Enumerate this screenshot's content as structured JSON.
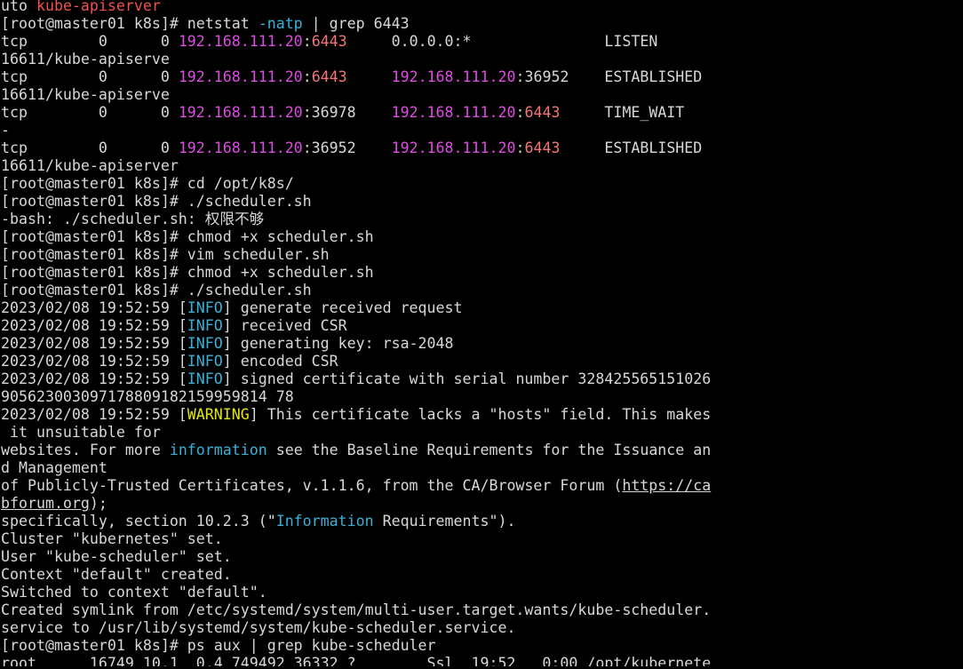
{
  "terminal": {
    "colors": {
      "background": "#000000",
      "foreground": "#d8d8d8",
      "red": "#f0524f",
      "magenta": "#e04be6",
      "salmon": "#f57575",
      "cyan": "#39b1d6",
      "yellow": "#e5e510"
    },
    "lines": [
      [
        {
          "t": "uto "
        },
        {
          "t": "kube-apiserver",
          "c": "red"
        }
      ],
      [
        {
          "t": "[root@master01 k8s]# netstat "
        },
        {
          "t": "-natp",
          "c": "cyan"
        },
        {
          "t": " | grep 6443"
        }
      ],
      [
        {
          "t": "tcp        0      0 "
        },
        {
          "t": "192.168.111.20",
          "c": "magenta"
        },
        {
          "t": ":"
        },
        {
          "t": "6443",
          "c": "salmon"
        },
        {
          "t": "     0.0.0.0:*               LISTEN"
        }
      ],
      [
        {
          "t": "16611/kube-apiserve"
        }
      ],
      [
        {
          "t": "tcp        0      0 "
        },
        {
          "t": "192.168.111.20",
          "c": "magenta"
        },
        {
          "t": ":"
        },
        {
          "t": "6443",
          "c": "salmon"
        },
        {
          "t": "     "
        },
        {
          "t": "192.168.111.20",
          "c": "magenta"
        },
        {
          "t": ":36952    ESTABLISHED"
        }
      ],
      [
        {
          "t": "16611/kube-apiserve"
        }
      ],
      [
        {
          "t": "tcp        0      0 "
        },
        {
          "t": "192.168.111.20",
          "c": "magenta"
        },
        {
          "t": ":36978    "
        },
        {
          "t": "192.168.111.20",
          "c": "magenta"
        },
        {
          "t": ":"
        },
        {
          "t": "6443",
          "c": "salmon"
        },
        {
          "t": "     TIME_WAIT"
        }
      ],
      [
        {
          "t": "-"
        }
      ],
      [
        {
          "t": "tcp        0      0 "
        },
        {
          "t": "192.168.111.20",
          "c": "magenta"
        },
        {
          "t": ":36952    "
        },
        {
          "t": "192.168.111.20",
          "c": "magenta"
        },
        {
          "t": ":"
        },
        {
          "t": "6443",
          "c": "salmon"
        },
        {
          "t": "     ESTABLISHED"
        }
      ],
      [
        {
          "t": "16611/kube-apiserver"
        }
      ],
      [
        {
          "t": "[root@master01 k8s]# cd /opt/k8s/"
        }
      ],
      [
        {
          "t": "[root@master01 k8s]# ./scheduler.sh"
        }
      ],
      [
        {
          "t": "-bash: ./scheduler.sh: 权限不够"
        }
      ],
      [
        {
          "t": "[root@master01 k8s]# chmod +x scheduler.sh"
        }
      ],
      [
        {
          "t": "[root@master01 k8s]# vim scheduler.sh"
        }
      ],
      [
        {
          "t": "[root@master01 k8s]# chmod +x scheduler.sh"
        }
      ],
      [
        {
          "t": "[root@master01 k8s]# ./scheduler.sh"
        }
      ],
      [
        {
          "t": "2023/02/08 19:52:59 ["
        },
        {
          "t": "INFO",
          "c": "cyan"
        },
        {
          "t": "] generate received request"
        }
      ],
      [
        {
          "t": "2023/02/08 19:52:59 ["
        },
        {
          "t": "INFO",
          "c": "cyan"
        },
        {
          "t": "] received CSR"
        }
      ],
      [
        {
          "t": "2023/02/08 19:52:59 ["
        },
        {
          "t": "INFO",
          "c": "cyan"
        },
        {
          "t": "] generating key: rsa-2048"
        }
      ],
      [
        {
          "t": "2023/02/08 19:52:59 ["
        },
        {
          "t": "INFO",
          "c": "cyan"
        },
        {
          "t": "] encoded CSR"
        }
      ],
      [
        {
          "t": "2023/02/08 19:52:59 ["
        },
        {
          "t": "INFO",
          "c": "cyan"
        },
        {
          "t": "] signed certificate with serial number 328425565151026"
        }
      ],
      [
        {
          "t": "905623003097178809182159959814 78"
        }
      ],
      [
        {
          "t": "2023/02/08 19:52:59 ["
        },
        {
          "t": "WARNING",
          "c": "yellow"
        },
        {
          "t": "] This certificate lacks a \"hosts\" field. This makes"
        }
      ],
      [
        {
          "t": " it unsuitable for"
        }
      ],
      [
        {
          "t": "websites. For more "
        },
        {
          "t": "information",
          "c": "cyan"
        },
        {
          "t": " see the Baseline Requirements for the Issuance an"
        }
      ],
      [
        {
          "t": "d Management"
        }
      ],
      [
        {
          "t": "of Publicly-Trusted Certificates, v.1.1.6, from the CA/Browser Forum ("
        },
        {
          "t": "https://ca",
          "u": true
        }
      ],
      [
        {
          "t": "bforum.org",
          "u": true
        },
        {
          "t": ");"
        }
      ],
      [
        {
          "t": "specifically, section 10.2.3 (\""
        },
        {
          "t": "Information",
          "c": "cyan"
        },
        {
          "t": " Requirements\")."
        }
      ],
      [
        {
          "t": "Cluster \"kubernetes\" set."
        }
      ],
      [
        {
          "t": "User \"kube-scheduler\" set."
        }
      ],
      [
        {
          "t": "Context \"default\" created."
        }
      ],
      [
        {
          "t": "Switched to context \"default\"."
        }
      ],
      [
        {
          "t": "Created symlink from /etc/systemd/system/multi-user.target.wants/kube-scheduler."
        }
      ],
      [
        {
          "t": "service to /usr/lib/systemd/system/kube-scheduler.service."
        }
      ],
      [
        {
          "t": "[root@master01 k8s]# ps aux | grep kube-scheduler"
        }
      ],
      [
        {
          "t": "root      16749 10.1  0.4 749492 36332 ?        Ssl  19:52   0:00 /opt/kubernete"
        }
      ]
    ]
  }
}
